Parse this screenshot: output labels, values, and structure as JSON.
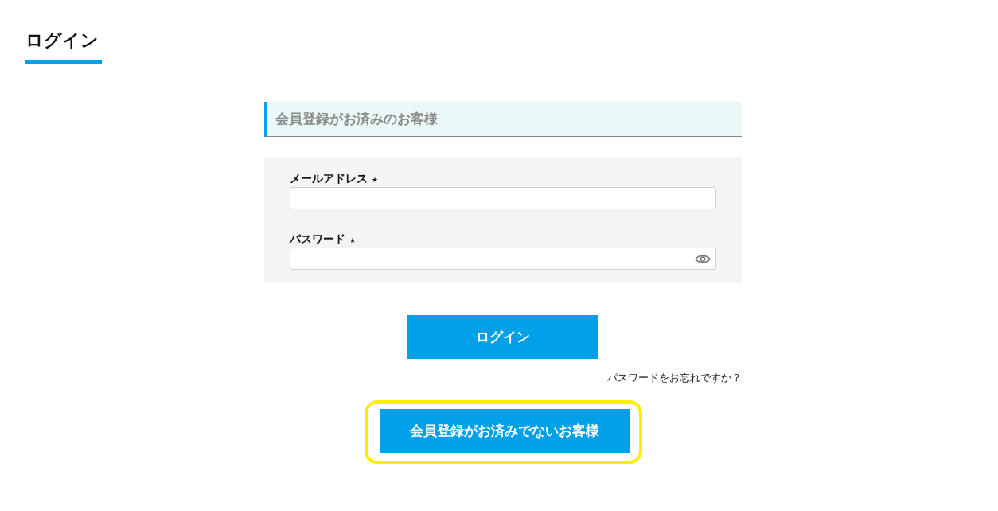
{
  "page_title": "ログイン",
  "section": {
    "title": "会員登録がお済みのお客様"
  },
  "fields": [
    {
      "label": "メールアドレス",
      "required_mark": "★",
      "reveal_toggle": false
    },
    {
      "label": "パスワード",
      "required_mark": "★",
      "reveal_toggle": true
    }
  ],
  "login_button": {
    "label": "ログイン"
  },
  "forgot_link": "パスワードをお忘れですか？",
  "register_button": {
    "label": "会員登録がお済みでないお客様",
    "highlighted": true
  }
}
